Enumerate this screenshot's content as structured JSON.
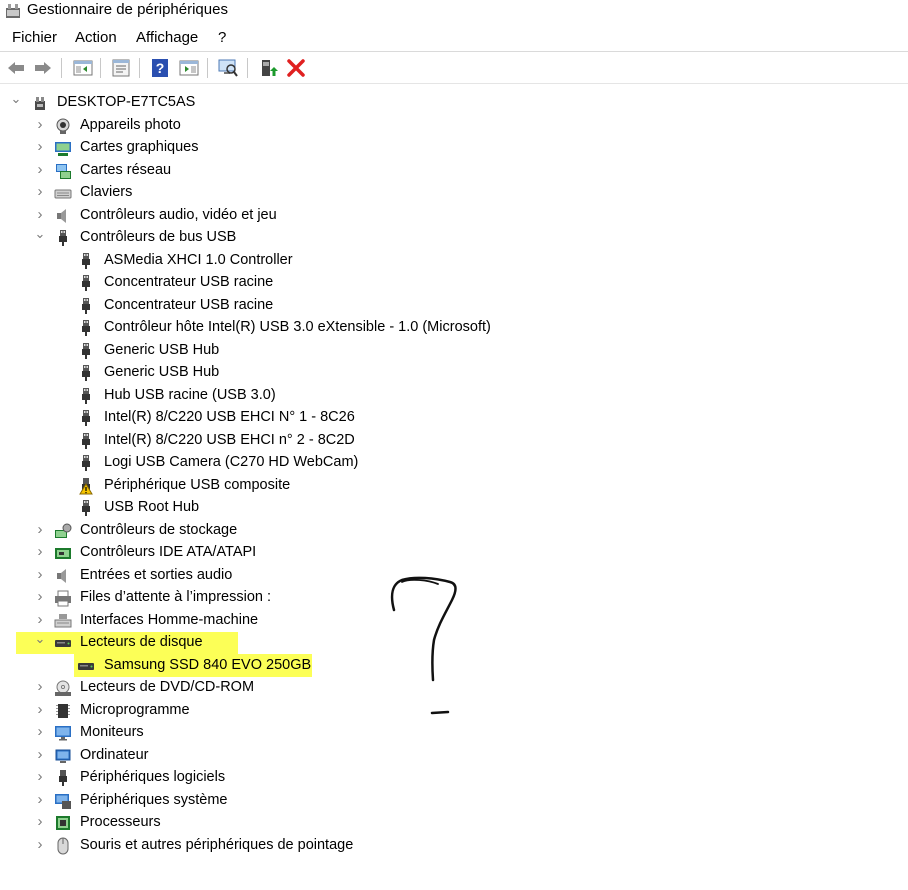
{
  "window": {
    "title": "Gestionnaire de périphériques"
  },
  "menu": [
    "Fichier",
    "Action",
    "Affichage",
    "?"
  ],
  "toolbar": {
    "buttons": [
      "back-icon",
      "forward-icon",
      "show-hide-console-tree-icon",
      "properties-icon",
      "help-icon",
      "action-pane-icon",
      "scan-hardware-icon",
      "update-driver-icon",
      "uninstall-device-icon"
    ]
  },
  "tree": {
    "root": "DESKTOP-E7TC5AS",
    "categories": [
      {
        "label": "Appareils photo",
        "icon": "camera-icon",
        "expanded": false
      },
      {
        "label": "Cartes graphiques",
        "icon": "display-adapter-icon",
        "expanded": false
      },
      {
        "label": "Cartes réseau",
        "icon": "network-adapter-icon",
        "expanded": false
      },
      {
        "label": "Claviers",
        "icon": "keyboard-icon",
        "expanded": false
      },
      {
        "label": "Contrôleurs audio, vidéo et jeu",
        "icon": "speaker-icon",
        "expanded": false
      },
      {
        "label": "Contrôleurs de bus USB",
        "icon": "usb-icon",
        "expanded": true,
        "children": [
          {
            "label": "ASMedia XHCI 1.0 Controller",
            "icon": "usb-icon"
          },
          {
            "label": "Concentrateur USB racine",
            "icon": "usb-icon"
          },
          {
            "label": "Concentrateur USB racine",
            "icon": "usb-icon"
          },
          {
            "label": "Contrôleur hôte Intel(R) USB 3.0 eXtensible - 1.0 (Microsoft)",
            "icon": "usb-icon"
          },
          {
            "label": "Generic USB Hub",
            "icon": "usb-icon"
          },
          {
            "label": "Generic USB Hub",
            "icon": "usb-icon"
          },
          {
            "label": "Hub USB racine (USB 3.0)",
            "icon": "usb-icon"
          },
          {
            "label": "Intel(R) 8/C220 USB EHCI N° 1 - 8C26",
            "icon": "usb-icon"
          },
          {
            "label": "Intel(R) 8/C220 USB EHCI n° 2 - 8C2D",
            "icon": "usb-icon"
          },
          {
            "label": "Logi USB Camera (C270 HD WebCam)",
            "icon": "usb-icon"
          },
          {
            "label": "Périphérique USB composite",
            "icon": "usb-warning-icon"
          },
          {
            "label": "USB Root Hub",
            "icon": "usb-icon"
          }
        ]
      },
      {
        "label": "Contrôleurs de stockage",
        "icon": "storage-controller-icon",
        "expanded": false
      },
      {
        "label": "Contrôleurs IDE ATA/ATAPI",
        "icon": "ide-controller-icon",
        "expanded": false
      },
      {
        "label": "Entrées et sorties audio",
        "icon": "speaker-icon",
        "expanded": false
      },
      {
        "label": "Files d’attente à l’impression :",
        "icon": "printer-icon",
        "expanded": false
      },
      {
        "label": "Interfaces Homme-machine",
        "icon": "hid-icon",
        "expanded": false
      },
      {
        "label": "Lecteurs de disque",
        "icon": "disk-drive-icon",
        "expanded": true,
        "highlighted": true,
        "children": [
          {
            "label": "Samsung SSD 840 EVO 250GB",
            "icon": "disk-drive-icon",
            "highlighted": true
          }
        ]
      },
      {
        "label": "Lecteurs de DVD/CD-ROM",
        "icon": "dvd-icon",
        "expanded": false
      },
      {
        "label": "Microprogramme",
        "icon": "firmware-icon",
        "expanded": false
      },
      {
        "label": "Moniteurs",
        "icon": "monitor-icon",
        "expanded": false
      },
      {
        "label": "Ordinateur",
        "icon": "computer-icon",
        "expanded": false
      },
      {
        "label": "Périphériques logiciels",
        "icon": "software-device-icon",
        "expanded": false
      },
      {
        "label": "Périphériques système",
        "icon": "system-device-icon",
        "expanded": false
      },
      {
        "label": "Processeurs",
        "icon": "processor-icon",
        "expanded": false
      },
      {
        "label": "Souris et autres périphériques de pointage",
        "icon": "mouse-icon",
        "expanded": false
      }
    ]
  },
  "colors": {
    "highlight": "#fbff3a",
    "icon_blue": "#2a6fc4",
    "error_red": "#e02020",
    "accent_green": "#1c9a2c"
  }
}
